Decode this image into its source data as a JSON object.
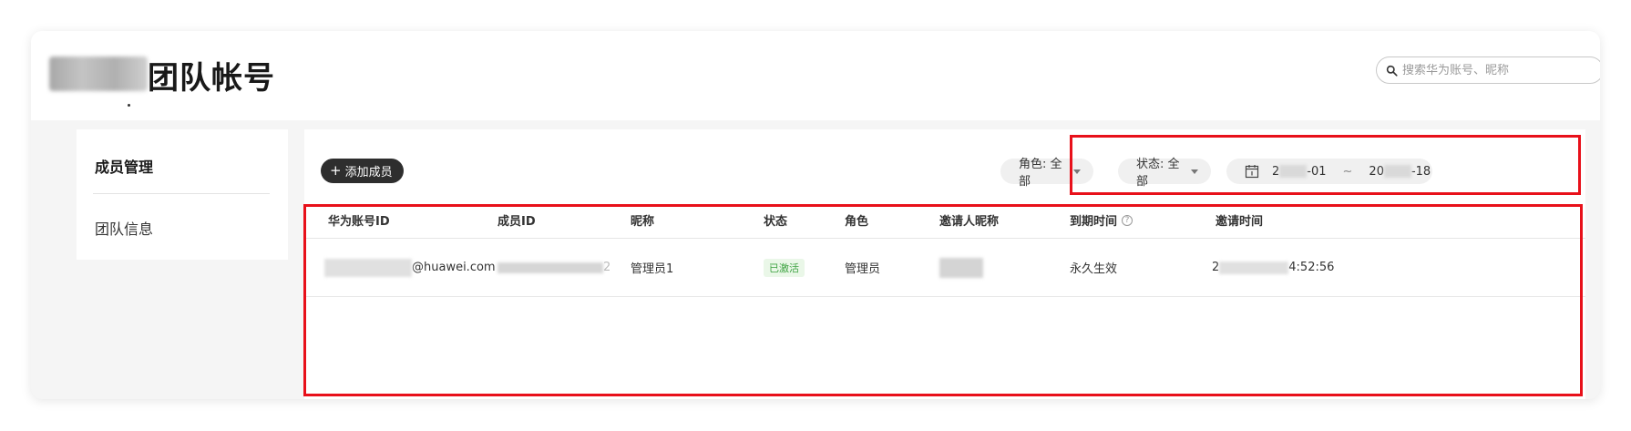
{
  "header": {
    "title": "团队帐号",
    "search_placeholder": "搜索华为账号、昵称"
  },
  "sidebar": {
    "items": [
      {
        "label": "成员管理",
        "active": true
      },
      {
        "label": "团队信息",
        "active": false
      }
    ]
  },
  "toolbar": {
    "add_label": "添加成员",
    "role_filter": "角色: 全部",
    "status_filter": "状态: 全部",
    "date_start_prefix": "2",
    "date_start_suffix": "-01",
    "date_separator": "~",
    "date_end_prefix": "20",
    "date_end_suffix": "-18"
  },
  "table": {
    "columns": [
      "华为账号ID",
      "成员ID",
      "昵称",
      "状态",
      "角色",
      "邀请人昵称",
      "到期时间",
      "邀请时间"
    ],
    "rows": [
      {
        "account_suffix": "@huawei.com",
        "member_id_suffix": "2",
        "nickname": "管理员1",
        "status": "已激活",
        "role": "管理员",
        "expiry": "永久生效",
        "invite_time_prefix": "2",
        "invite_time_suffix": "4:52:56"
      }
    ]
  },
  "colors": {
    "accent": "#2e2e2e",
    "status_active": "#3ea342",
    "highlight": "#e8101a"
  }
}
